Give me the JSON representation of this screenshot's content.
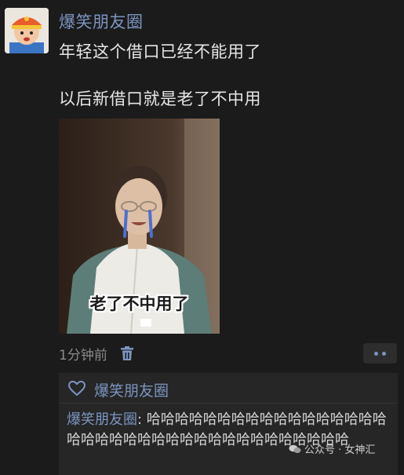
{
  "post": {
    "username": "爆笑朋友圈",
    "lines": [
      "年轻这个借口已经不能用了",
      "以后新借口就是老了不中用"
    ],
    "image_caption": "老了不中用了",
    "time": "1分钟前"
  },
  "comments": {
    "likes": [
      "爆笑朋友圈"
    ],
    "items": [
      {
        "author": "爆笑朋友圈",
        "separator": ": ",
        "text": "哈哈哈哈哈哈哈哈哈哈哈哈哈哈哈哈哈哈哈哈哈哈哈哈哈哈哈哈哈哈哈哈哈哈哈哈哈"
      }
    ]
  },
  "watermark": "公众号 · 女神汇",
  "colors": {
    "background": "#1b1b1b",
    "link_blue": "#7c94c0",
    "comment_bg": "#262626"
  },
  "icons": [
    "avatar",
    "trash-icon",
    "more-dots-icon",
    "heart-icon",
    "wechat-icon"
  ]
}
